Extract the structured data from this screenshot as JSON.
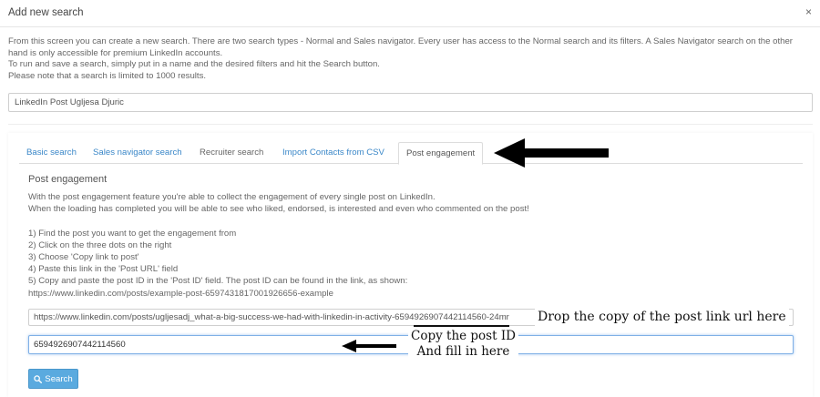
{
  "modal": {
    "title": "Add new search",
    "close_label": "×"
  },
  "intro": {
    "lines": [
      "From this screen you can create a new search. There are two search types - Normal and Sales navigator. Every user has access to the Normal search and its filters. A Sales Navigator search on the other",
      "hand is only accessible for premium LinkedIn accounts.",
      "To run and save a search, simply put in a name and the desired filters and hit the Search button.",
      "Please note that a search is limited to 1000 results."
    ]
  },
  "search_name": {
    "value": "LinkedIn Post Ugljesa Djuric"
  },
  "tabs": [
    {
      "label": "Basic search"
    },
    {
      "label": "Sales navigator search"
    },
    {
      "label": "Recruiter search"
    },
    {
      "label": "Import Contacts from CSV"
    },
    {
      "label": "Post engagement"
    }
  ],
  "active_tab": "Post engagement",
  "post_engagement": {
    "title": "Post engagement",
    "description": [
      "With the post engagement feature you're able to collect the engagement of every single post on LinkedIn.",
      "When the loading has completed you will be able to see who liked, endorsed, is interested and even who commented on the post!",
      "",
      "1) Find the post you want to get the engagement from",
      "2) Click on the three dots on the right",
      "3) Choose 'Copy link to post'",
      "4) Paste this link in the 'Post URL' field",
      "5) Copy and paste the post ID in the 'Post ID' field. The post ID can be found in the link, as shown:",
      "https://www.linkedin.com/posts/example-post-6597431817001926656-example"
    ],
    "post_url_value": "https://www.linkedin.com/posts/ugljesadj_what-a-big-success-we-had-with-linkedin-in-activity-6594926907442114560-24mr",
    "post_id_value": "6594926907442114560",
    "search_button_label": "Search"
  },
  "annotations": {
    "url_note": "Drop the copy of the post link url here",
    "id_note_line1": "Copy the post ID",
    "id_note_line2": "And fill in here"
  },
  "colors": {
    "link": "#3a87c8",
    "button": "#5aaadf",
    "focus_border": "#7fb0e6",
    "annotation_arrow": "#000000"
  },
  "icons": {
    "search_button": "search-icon",
    "close": "close-icon"
  }
}
